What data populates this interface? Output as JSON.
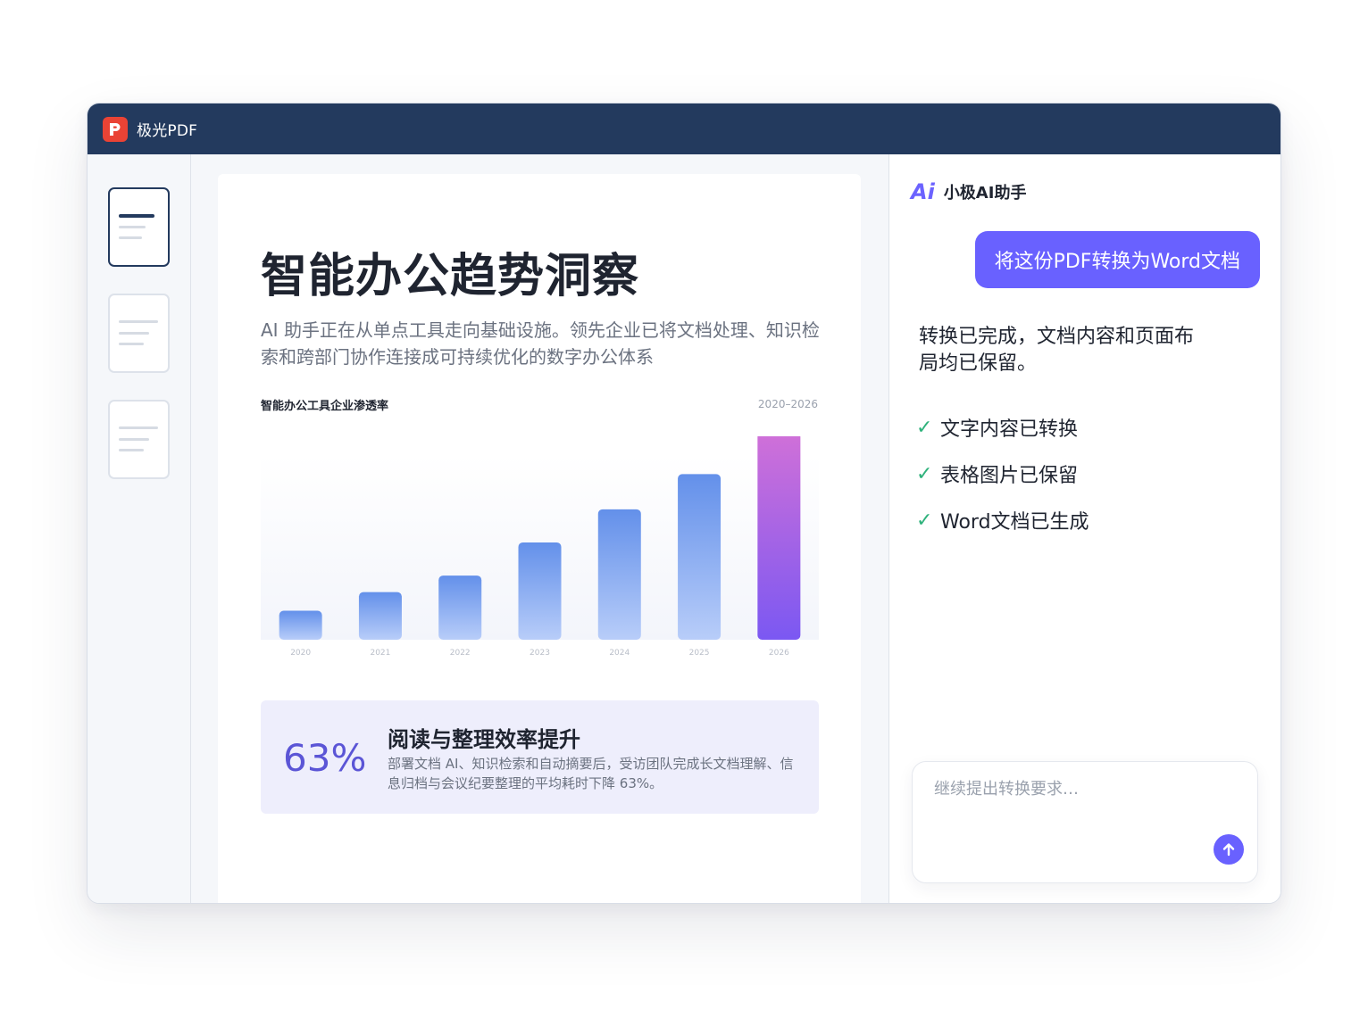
{
  "app": {
    "title": "极光PDF",
    "logo_letter": "P",
    "brand_color": "#ea4335",
    "titlebar_color": "#233a5e"
  },
  "thumbnails": [
    {
      "active": true
    },
    {
      "active": false
    },
    {
      "active": false
    }
  ],
  "document": {
    "title": "智能办公趋势洞察",
    "subtitle": "AI 助手正在从单点工具走向基础设施。领先企业已将文档处理、知识检索和跨部门协作连接成可持续优化的数字办公体系",
    "chart_title": "智能办公工具企业渗透率",
    "chart_range": "2020–2026",
    "stat_value": "63%",
    "stat_heading": "阅读与整理效率提升",
    "stat_description": "部署文档 AI、知识检索和自动摘要后，受访团队完成长文档理解、信息归档与会议纪要整理的平均耗时下降 63%。"
  },
  "chart_data": {
    "type": "bar",
    "title": "智能办公工具企业渗透率",
    "categories": [
      "2020",
      "2021",
      "2022",
      "2023",
      "2024",
      "2025",
      "2026"
    ],
    "values": [
      14,
      23,
      31,
      47,
      63,
      80,
      100
    ],
    "ylim": [
      0,
      100
    ],
    "grid": false,
    "highlight_index": 6,
    "colors": {
      "bar_top": "#6390ea",
      "bar_bottom": "#b8cdf9",
      "highlight_top": "#d070d8",
      "highlight_bottom": "#7b58f2"
    }
  },
  "assistant": {
    "logo_text": "Ai",
    "name": "小极AI助手",
    "user_message": "将这份PDF转换为Word文档",
    "reply": "转换已完成，文档内容和页面布局均已保留。",
    "checklist": [
      {
        "icon": "check-icon",
        "label": "文字内容已转换"
      },
      {
        "icon": "check-icon",
        "label": "表格图片已保留"
      },
      {
        "icon": "check-icon",
        "label": "Word文档已生成"
      }
    ],
    "input_placeholder": "继续提出转换要求…",
    "accent_color": "#6961ff"
  }
}
